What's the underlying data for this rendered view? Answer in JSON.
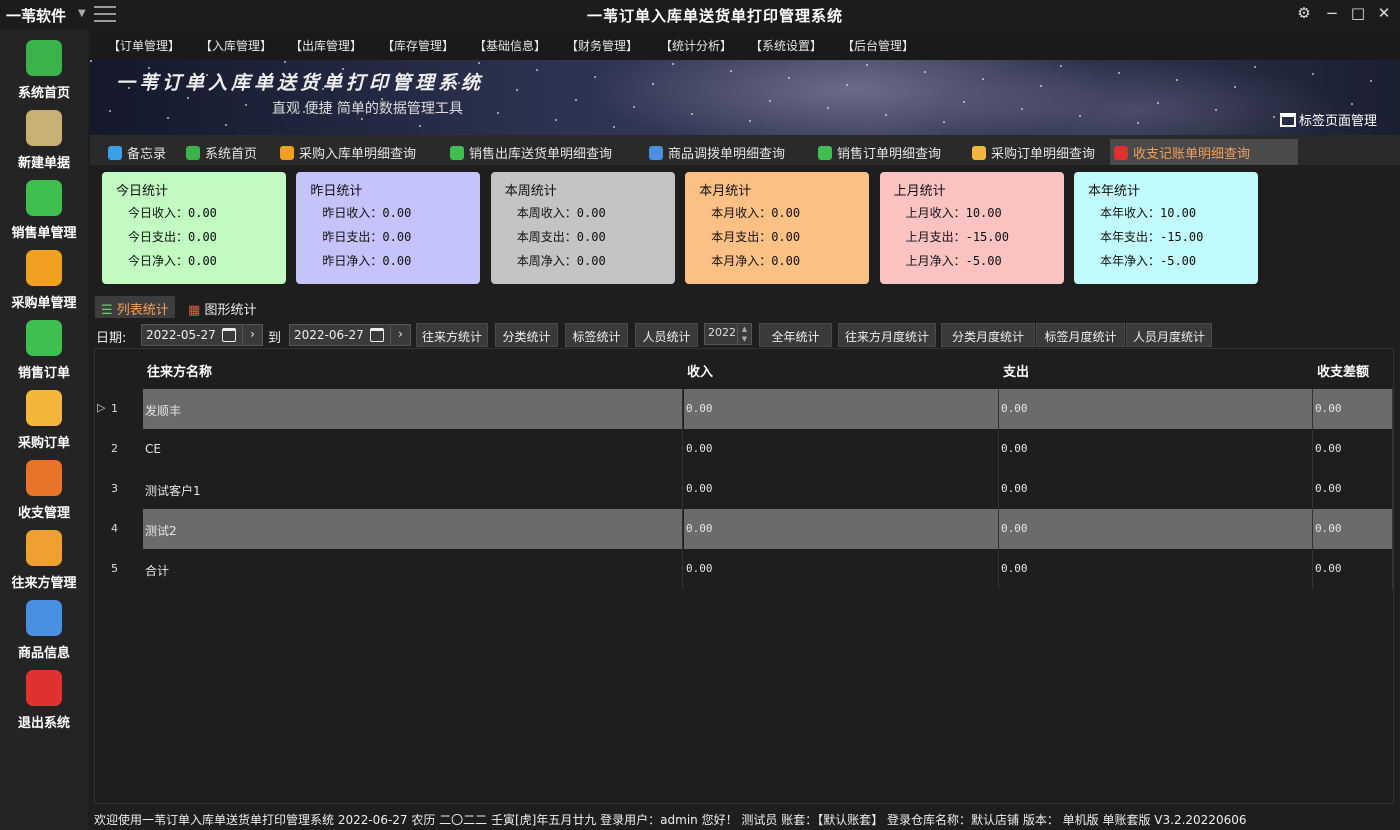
{
  "app": {
    "brand": "一苇软件",
    "title": "一苇订单入库单送货单打印管理系统"
  },
  "sidebar": [
    {
      "label": "系统首页",
      "color": "#3bb34a"
    },
    {
      "label": "新建单据",
      "color": "#c9b074"
    },
    {
      "label": "销售单管理",
      "color": "#3fbf4f"
    },
    {
      "label": "采购单管理",
      "color": "#f0a020"
    },
    {
      "label": "销售订单",
      "color": "#3fbf4f"
    },
    {
      "label": "采购订单",
      "color": "#f3b53a"
    },
    {
      "label": "收支管理",
      "color": "#e8742a"
    },
    {
      "label": "往来方管理",
      "color": "#f0a030"
    },
    {
      "label": "商品信息",
      "color": "#4a90e2"
    },
    {
      "label": "退出系统",
      "color": "#e03030"
    }
  ],
  "menu": [
    "【订单管理】",
    "【入库管理】",
    "【出库管理】",
    "【库存管理】",
    "【基础信息】",
    "【财务管理】",
    "【统计分析】",
    "【系统设置】",
    "【后台管理】"
  ],
  "banner": {
    "title": "一苇订单入库单送货单打印管理系统",
    "subtitle": "直观 便捷 简单的数据管理工具",
    "tag_manage": "标签页面管理"
  },
  "tabs": [
    {
      "label": "备忘录",
      "color": "#3aa0e8"
    },
    {
      "label": "系统首页",
      "color": "#3bb34a"
    },
    {
      "label": "采购入库单明细查询",
      "color": "#f0a020"
    },
    {
      "label": "销售出库送货单明细查询",
      "color": "#3fbf4f"
    },
    {
      "label": "商品调拨单明细查询",
      "color": "#4a90e2"
    },
    {
      "label": "销售订单明细查询",
      "color": "#3fbf4f"
    },
    {
      "label": "采购订单明细查询",
      "color": "#f3b53a"
    },
    {
      "label": "收支记账单明细查询",
      "color": "#e03030",
      "active": true
    }
  ],
  "cards": [
    {
      "title": "今日统计",
      "color": "#c2fbc2",
      "lines": [
        "今日收入：0.00",
        "今日支出：0.00",
        "今日净入：0.00"
      ]
    },
    {
      "title": "昨日统计",
      "color": "#c4c4fb",
      "lines": [
        "昨日收入：0.00",
        "昨日支出：0.00",
        "昨日净入：0.00"
      ]
    },
    {
      "title": "本周统计",
      "color": "#c4c4c4",
      "lines": [
        "本周收入：0.00",
        "本周支出：0.00",
        "本周净入：0.00"
      ]
    },
    {
      "title": "本月统计",
      "color": "#fbc184",
      "lines": [
        "本月收入：0.00",
        "本月支出：0.00",
        "本月净入：0.00"
      ]
    },
    {
      "title": "上月统计",
      "color": "#fbc2c2",
      "lines": [
        "上月收入：10.00",
        "上月支出：-15.00",
        "上月净入：-5.00"
      ]
    },
    {
      "title": "本年统计",
      "color": "#c2fbfb",
      "lines": [
        "本年收入：10.00",
        "本年支出：-15.00",
        "本年净入：-5.00"
      ]
    }
  ],
  "subtabs": {
    "list": "列表统计",
    "chart": "图形统计"
  },
  "filter": {
    "date_label": "日期:",
    "from": "2022-05-27",
    "to_label": "到",
    "to": "2022-06-27",
    "year": "2022",
    "buttons_a": [
      "往来方统计",
      "分类统计",
      "标签统计",
      "人员统计"
    ],
    "buttons_b": [
      "全年统计",
      "往来方月度统计",
      "分类月度统计",
      "标签月度统计",
      "人员月度统计"
    ]
  },
  "grid": {
    "headers": [
      "往来方名称",
      "收入",
      "支出",
      "收支差额"
    ],
    "rows": [
      {
        "no": "1",
        "name": "发顺丰",
        "income": "0.00",
        "expense": "0.00",
        "diff": "0.00",
        "hl": true
      },
      {
        "no": "2",
        "name": "CE",
        "income": "0.00",
        "expense": "0.00",
        "diff": "0.00",
        "hl": false
      },
      {
        "no": "3",
        "name": "测试客户1",
        "income": "0.00",
        "expense": "0.00",
        "diff": "0.00",
        "hl": false
      },
      {
        "no": "4",
        "name": "测试2",
        "income": "0.00",
        "expense": "0.00",
        "diff": "0.00",
        "hl": true
      },
      {
        "no": "5",
        "name": "合计",
        "income": "0.00",
        "expense": "0.00",
        "diff": "0.00",
        "hl": false
      }
    ]
  },
  "status": "欢迎使用一苇订单入库单送货单打印管理系统 2022-06-27 农历 二〇二二 壬寅[虎]年五月廿九 登录用户：admin 您好！ 测试员 账套：【默认账套】 登录仓库名称：默认店铺 版本： 单机版 单账套版 V3.2.20220606"
}
